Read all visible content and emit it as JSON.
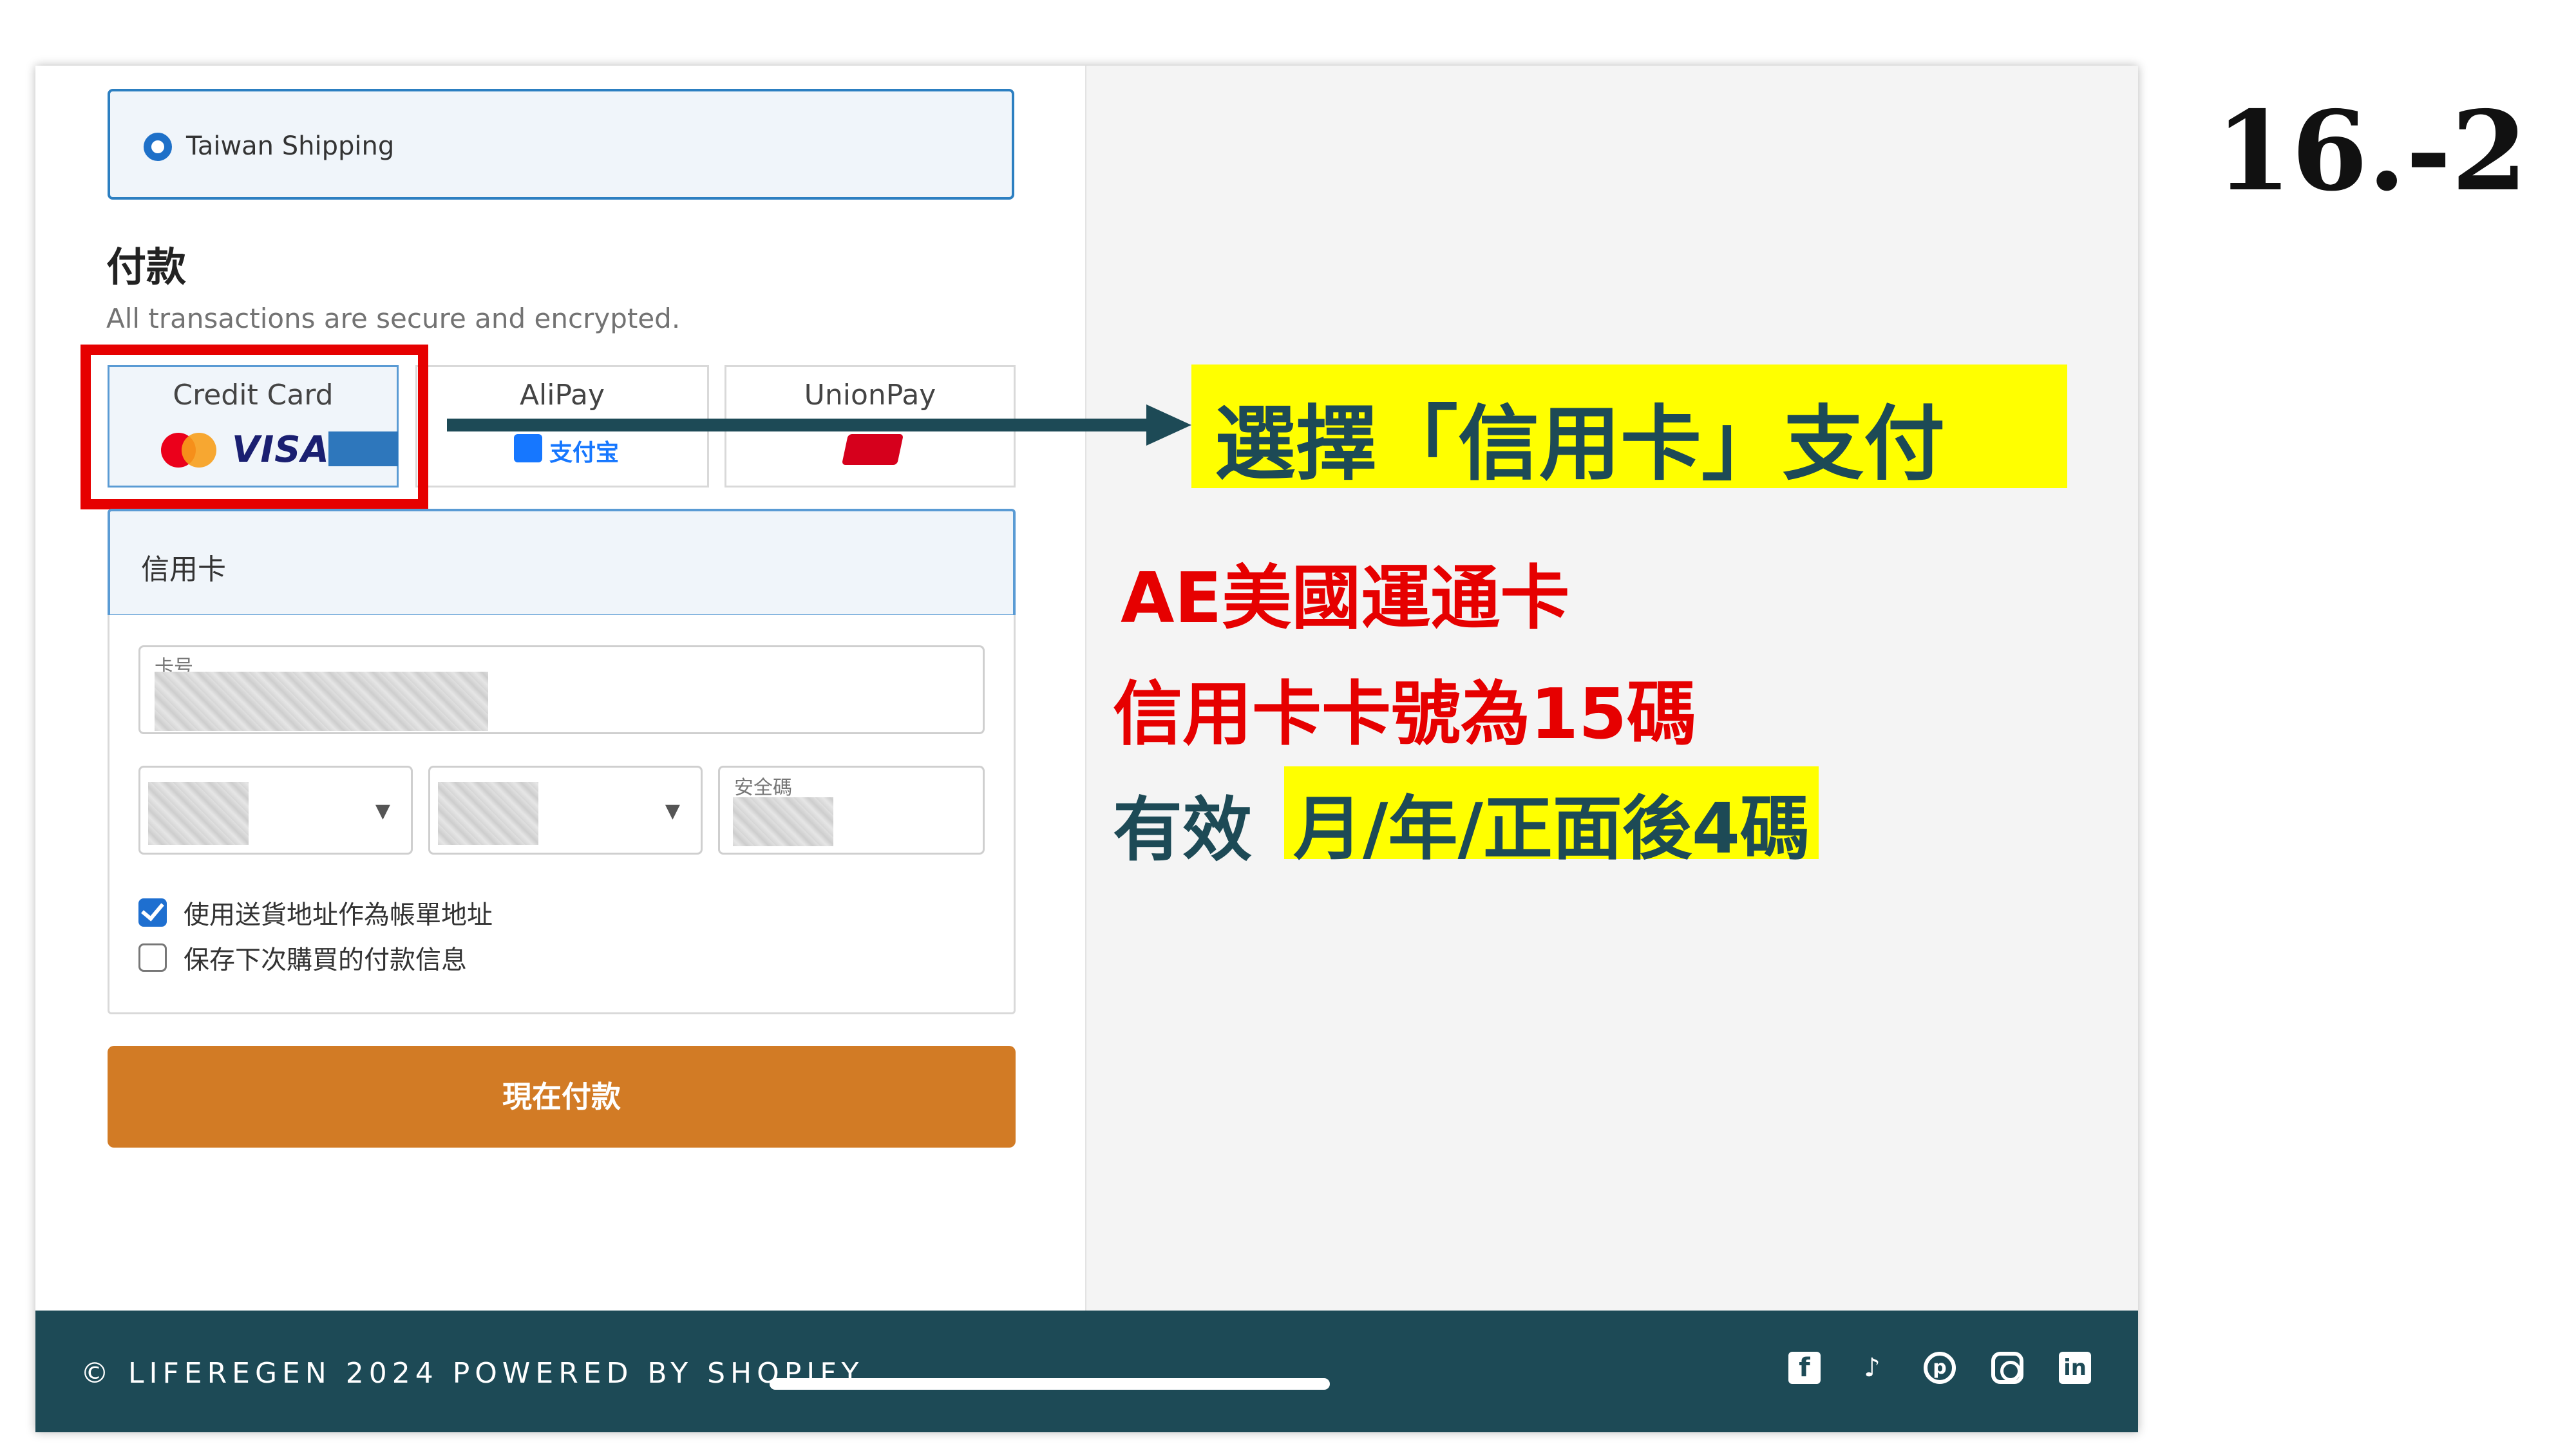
{
  "shipping": {
    "option_label": "Taiwan Shipping"
  },
  "payment": {
    "title": "付款",
    "subtitle": "All transactions are secure and encrypted.",
    "methods": [
      {
        "label": "Credit Card",
        "selected": true,
        "logos": [
          "mastercard-icon",
          "visa-icon",
          "amex-icon"
        ]
      },
      {
        "label": "AliPay",
        "selected": false,
        "logo_text": "支付宝"
      },
      {
        "label": "UnionPay",
        "selected": false,
        "logos": [
          "unionpay-icon"
        ]
      }
    ]
  },
  "credit_card_form": {
    "header": "信用卡",
    "card_number_label": "卡号",
    "cvv_label": "安全碼",
    "use_shipping_as_billing_label": "使用送貨地址作為帳單地址",
    "use_shipping_as_billing_checked": true,
    "save_payment_label": "保存下次購買的付款信息",
    "save_payment_checked": false
  },
  "pay_button_label": "現在付款",
  "footer": {
    "copyright": "© LIFEREGEN 2024 POWERED BY SHOPIFY",
    "social_icons": [
      "facebook-icon",
      "tiktok-icon",
      "pinterest-icon",
      "instagram-icon",
      "linkedin-icon"
    ]
  },
  "annotations": {
    "slide_number": "16.-2",
    "callout": "選擇「信用卡」支付",
    "note_1": "AE美國運通卡",
    "note_2": "信用卡卡號為15碼",
    "note_3_prefix": "有效",
    "note_3_highlight": "月/年/正面後4碼"
  },
  "colors": {
    "accent_blue": "#2c7fc1",
    "pay_button": "#d27b25",
    "footer_bg": "#1d4a56",
    "highlight_red": "#e60000",
    "callout_yellow": "#ffff00"
  }
}
